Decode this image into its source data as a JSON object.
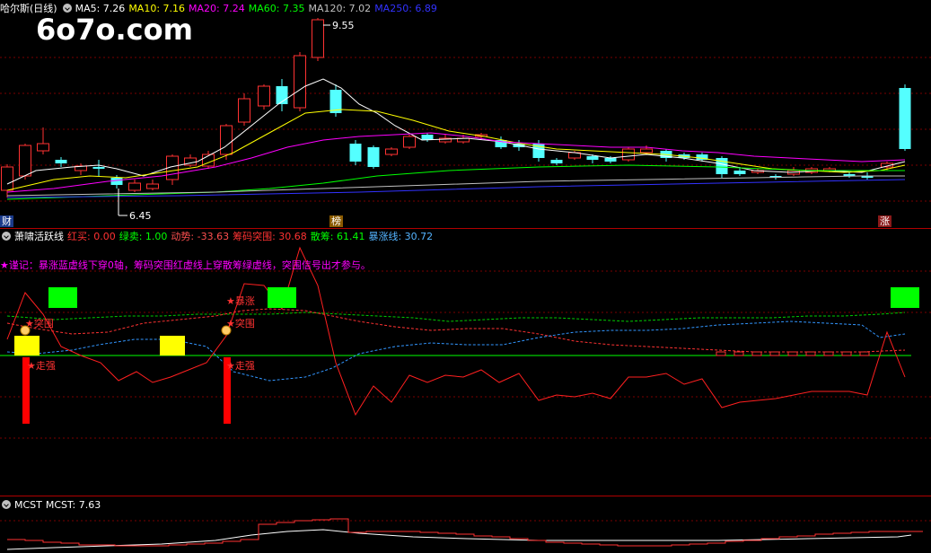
{
  "watermark": "6o7o.com",
  "main_header": {
    "title": "哈尔斯(日线)",
    "ma5": "MA5: 7.26",
    "ma10": "MA10: 7.16",
    "ma20": "MA20: 7.24",
    "ma60": "MA60: 7.35",
    "ma120": "MA120: 7.02",
    "ma250": "MA250: 6.89"
  },
  "price_labels": {
    "high": "9.55",
    "low": "6.45"
  },
  "markers": {
    "cai": "财",
    "bang": "榜",
    "zhang": "涨"
  },
  "ind_header": {
    "title": "萧啸活跃线",
    "hongmai": "红买: 0.00",
    "lvmai": "绿卖: 1.00",
    "dongshi": "动势: -33.63",
    "choumatuwei": "筹码突围: 30.68",
    "sanchou": "散筹: 61.41",
    "baozhangxian": "暴涨线: 30.72"
  },
  "note": "★谨记：暴涨蓝虚线下穿0轴，筹码突围红虚线上穿散筹绿虚线，突围信号出才参与。",
  "signals": {
    "tuwei1": "★突围",
    "zougiang1": "★走强",
    "baozhang": "★暴涨",
    "tuwei2": "★突围",
    "zougiang2": "★走强"
  },
  "mcst_header": {
    "title": "MCST",
    "value": "MCST: 7.63"
  },
  "colors": {
    "up": "#ff3232",
    "down": "#54ffff",
    "ma5": "#ffffff",
    "ma10": "#ffff00",
    "ma20": "#ff00ff",
    "ma60": "#00ff00",
    "ma120": "#c0c0c0",
    "ma250": "#3232ff",
    "divider": "#b00000"
  }
}
